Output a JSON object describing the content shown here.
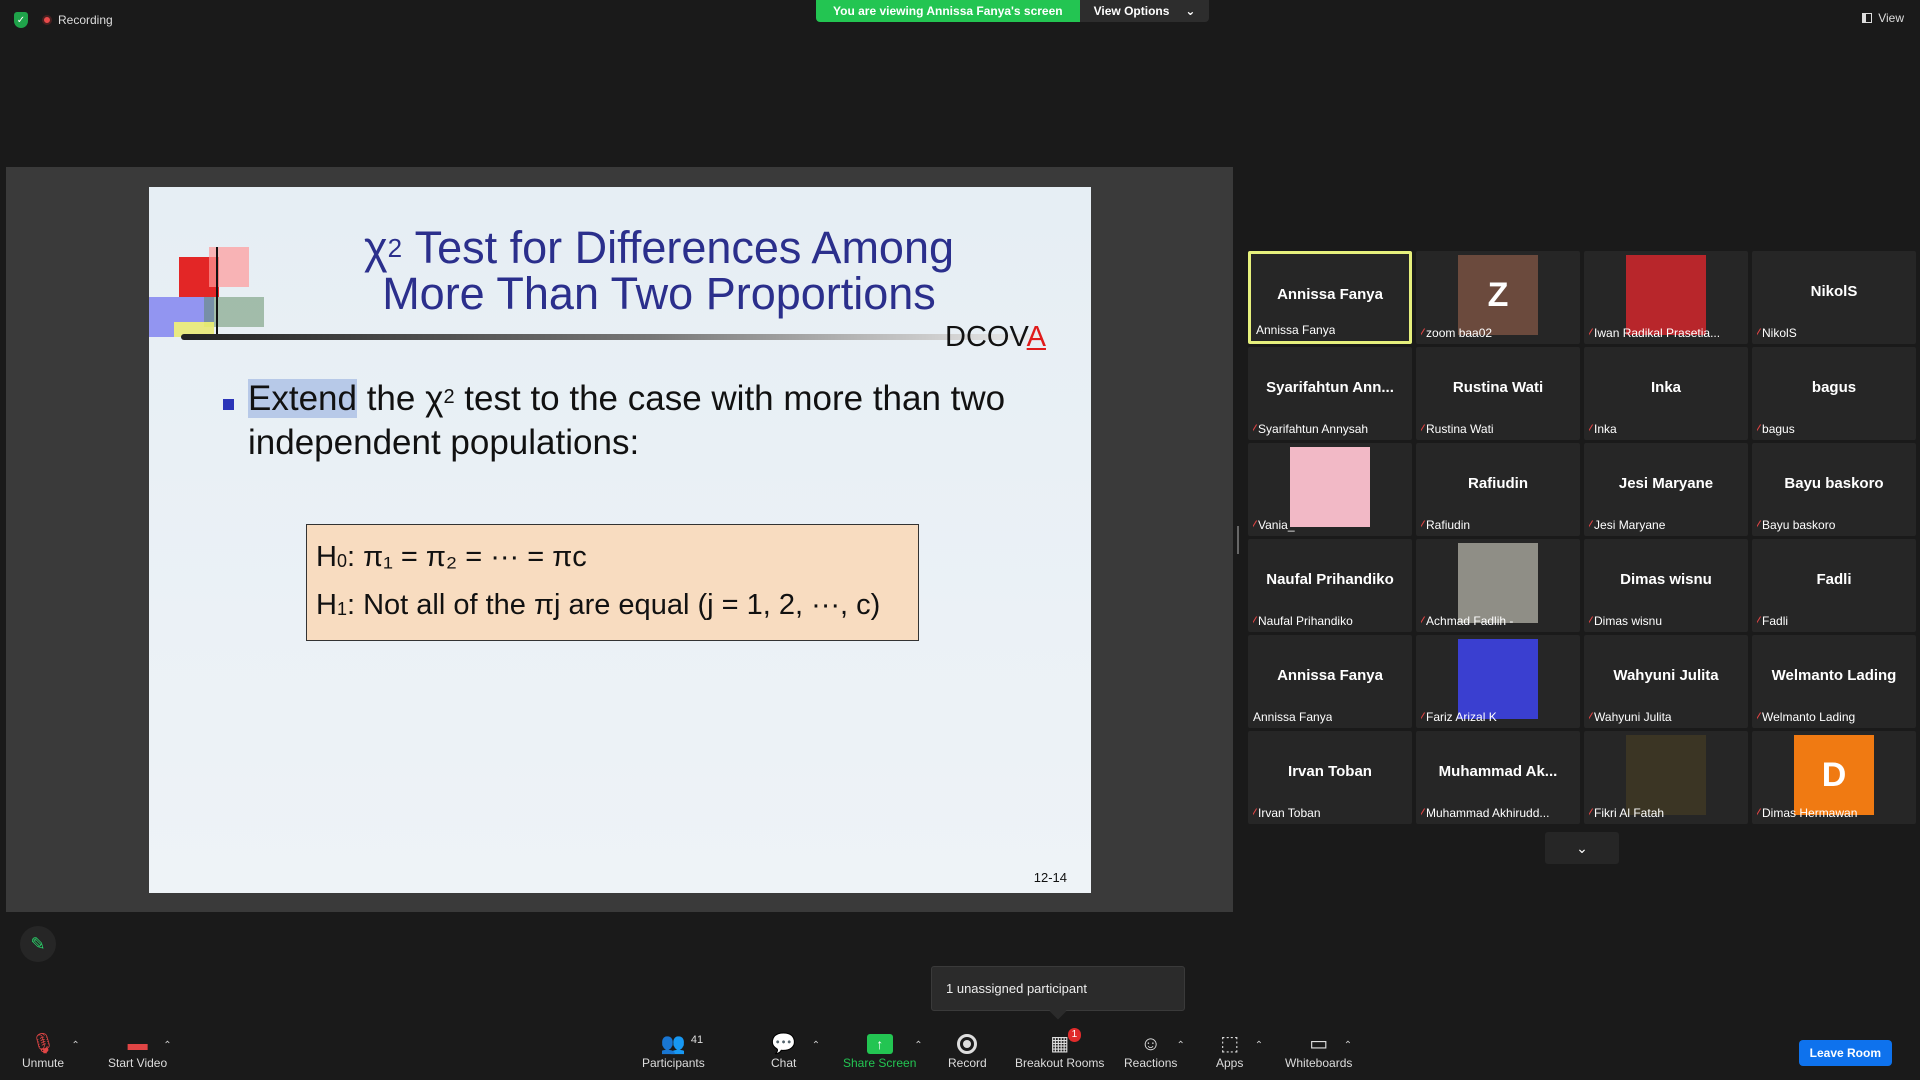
{
  "top": {
    "recording_label": "Recording",
    "viewing_text": "You are viewing Annissa Fanya's screen",
    "view_options_label": "View Options",
    "view_label": "View"
  },
  "slide": {
    "title_prefix": "χ",
    "title_sup": "2",
    "title_rest": " Test for Differences Among",
    "title_line2": "More Than Two Proportions",
    "dcova_main": "DCOV",
    "dcova_a": "A",
    "bullet_hl": "Extend",
    "bullet_mid": " the χ",
    "bullet_sup": "2",
    "bullet_rest": " test to the case with more than two independent populations:",
    "h0_label": "H",
    "h0_sub": "0",
    "h0_text": ": π₁ = π₂ = ··· = πc",
    "h1_label": "H",
    "h1_sub": "1",
    "h1_text": ": Not all of the πj are equal (j = 1, 2, ···, c)",
    "page_number": "12-14"
  },
  "participants": [
    {
      "big": "Annissa Fanya",
      "label": "Annissa Fanya",
      "muted": false,
      "active": true
    },
    {
      "big": "",
      "label": "zoom baa02",
      "muted": true,
      "avatar": "Z",
      "avatar_color": "#6b4a3d"
    },
    {
      "big": "",
      "label": "Iwan Radikal Prasetia...",
      "muted": true,
      "photo": "#b8262b"
    },
    {
      "big": "NikolS",
      "label": "NikolS",
      "muted": true
    },
    {
      "big": "Syarifahtun Ann...",
      "label": "Syarifahtun Annysah",
      "muted": true
    },
    {
      "big": "Rustina Wati",
      "label": "Rustina Wati",
      "muted": true
    },
    {
      "big": "Inka",
      "label": "Inka",
      "muted": true
    },
    {
      "big": "bagus",
      "label": "bagus",
      "muted": true
    },
    {
      "big": "",
      "label": "Vania_",
      "muted": true,
      "photo": "#f2b9c6"
    },
    {
      "big": "Rafiudin",
      "label": "Rafiudin",
      "muted": true
    },
    {
      "big": "Jesi Maryane",
      "label": "Jesi Maryane",
      "muted": true
    },
    {
      "big": "Bayu baskoro",
      "label": "Bayu baskoro",
      "muted": true
    },
    {
      "big": "Naufal Prihandiko",
      "label": "Naufal Prihandiko",
      "muted": true
    },
    {
      "big": "",
      "label": "Achmad Fadlih -",
      "muted": true,
      "photo": "#8f8e86"
    },
    {
      "big": "Dimas wisnu",
      "label": "Dimas wisnu",
      "muted": true
    },
    {
      "big": "Fadli",
      "label": "Fadli",
      "muted": true
    },
    {
      "big": "Annissa Fanya",
      "label": "Annissa Fanya",
      "muted": false
    },
    {
      "big": "",
      "label": "Fariz Arizal K",
      "muted": true,
      "photo": "#3a3fd0"
    },
    {
      "big": "Wahyuni Julita",
      "label": "Wahyuni Julita",
      "muted": true
    },
    {
      "big": "Welmanto Lading",
      "label": "Welmanto Lading",
      "muted": true
    },
    {
      "big": "Irvan Toban",
      "label": "Irvan Toban",
      "muted": true
    },
    {
      "big": "Muhammad Ak...",
      "label": "Muhammad Akhirudd...",
      "muted": true
    },
    {
      "big": "",
      "label": "Fikri Al Fatah",
      "muted": true,
      "photo": "#3b3524"
    },
    {
      "big": "",
      "label": "Dimas Hermawan",
      "muted": true,
      "avatar": "D",
      "avatar_color": "#f07a12"
    }
  ],
  "tooltip": "1 unassigned participant",
  "toolbar": {
    "unmute": "Unmute",
    "start_video": "Start Video",
    "participants": "Participants",
    "participants_count": "41",
    "chat": "Chat",
    "share_screen": "Share Screen",
    "record": "Record",
    "breakout_rooms": "Breakout Rooms",
    "breakout_badge": "1",
    "reactions": "Reactions",
    "apps": "Apps",
    "whiteboards": "Whiteboards",
    "leave_room": "Leave Room"
  },
  "colors": {
    "accent_green": "#23c552",
    "leave_blue": "#0e72ed",
    "active_border": "#e6f07c",
    "slide_title": "#2b2f8c"
  }
}
